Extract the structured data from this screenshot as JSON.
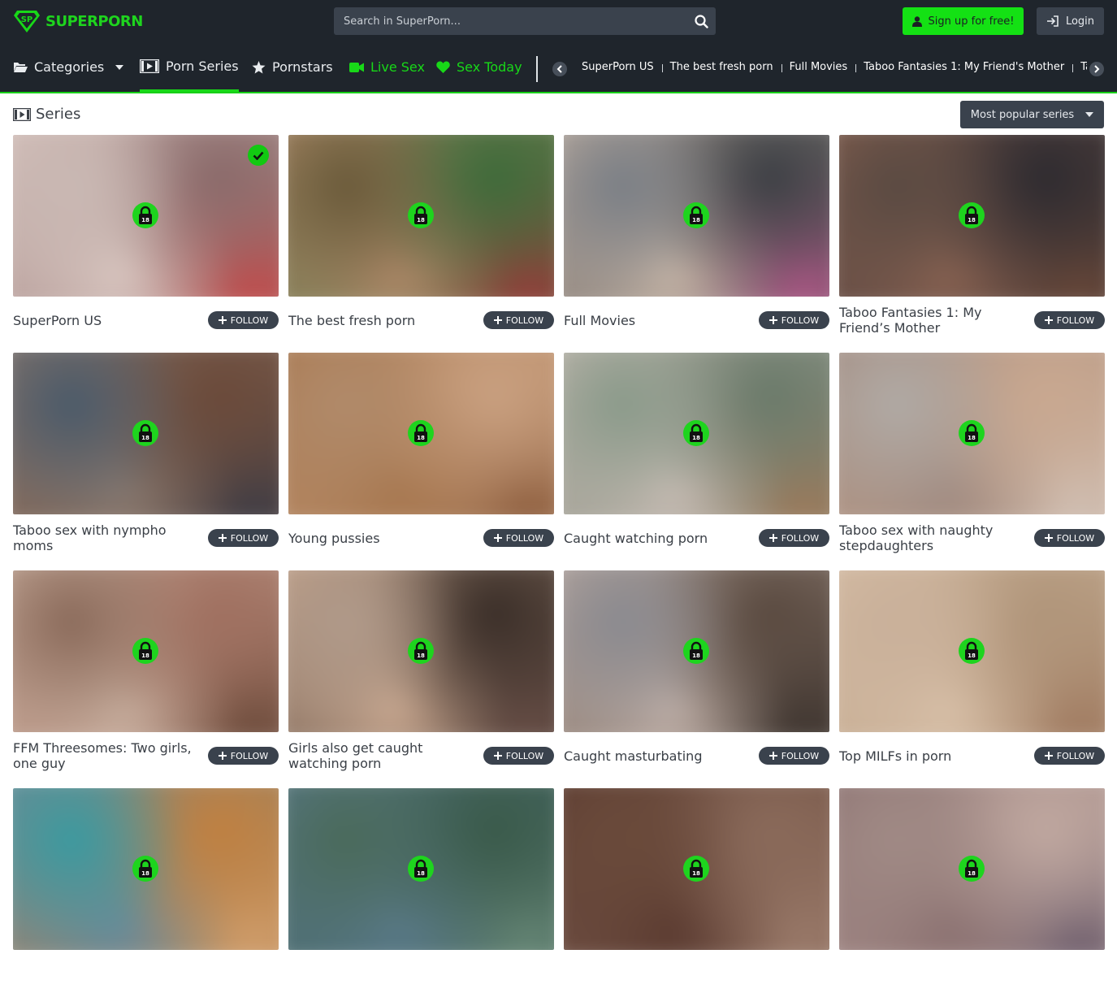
{
  "brand": {
    "name": "SUPERPORN",
    "logo_text": "SP",
    "accent": "#18d818"
  },
  "search": {
    "placeholder": "Search in SuperPorn...",
    "icon": "search-icon"
  },
  "auth": {
    "signup_label": "Sign up for free!",
    "login_label": "Login"
  },
  "nav": {
    "categories": "Categories",
    "porn_series": "Porn Series",
    "pornstars": "Pornstars",
    "live_sex": "Live Sex",
    "sex_today": "Sex Today"
  },
  "series_strip": [
    "SuperPorn US",
    "The best fresh porn",
    "Full Movies",
    "Taboo Fantasies 1: My Friend's Mother",
    "Taboo sex with nympho moms"
  ],
  "page": {
    "section_title": "Series",
    "sort_label": "Most popular series"
  },
  "follow_label": "FOLLOW",
  "lock_badge": "18",
  "cards": [
    {
      "title": "SuperPorn US",
      "followed": true,
      "colors": [
        "#c9b8b3",
        "#8a6a6a",
        "#d9c6c0",
        "#c54a4a"
      ]
    },
    {
      "title": "The best fresh porn",
      "followed": false,
      "colors": [
        "#6b5a3a",
        "#3e6b3a",
        "#b08a6a",
        "#9a3a3a"
      ]
    },
    {
      "title": "Full Movies",
      "followed": false,
      "colors": [
        "#7a7f86",
        "#3c3f44",
        "#c9b7a8",
        "#b45a8a"
      ]
    },
    {
      "title": "Taboo Fantasies 1: My Friend’s Mother",
      "followed": false,
      "colors": [
        "#5a4a42",
        "#2e2b30",
        "#8a6352",
        "#6d4a3a"
      ]
    },
    {
      "title": "Taboo sex with nympho moms",
      "followed": false,
      "colors": [
        "#4a5a6a",
        "#6b4a3a",
        "#8a7a70",
        "#3c3c46"
      ]
    },
    {
      "title": "Young pussies",
      "followed": false,
      "colors": [
        "#b08a6a",
        "#c9a080",
        "#a6764e",
        "#8a5a3a"
      ]
    },
    {
      "title": "Caught watching porn",
      "followed": false,
      "colors": [
        "#8a9a8a",
        "#6a7a6a",
        "#c9bdb5",
        "#a07a5a"
      ]
    },
    {
      "title": "Taboo sex with naughty stepdaughters",
      "followed": false,
      "colors": [
        "#b0aaa5",
        "#c9a890",
        "#a08a80",
        "#d0c0b5"
      ]
    },
    {
      "title": "FFM Threesomes: Two girls, one guy",
      "followed": false,
      "colors": [
        "#8a6a5a",
        "#a07060",
        "#c9b0a0",
        "#6a4a3a"
      ]
    },
    {
      "title": "Girls also get caught watching porn",
      "followed": false,
      "colors": [
        "#b09a8a",
        "#3a2e28",
        "#c9a890",
        "#6a5048"
      ]
    },
    {
      "title": "Caught masturbating",
      "followed": false,
      "colors": [
        "#8a8a90",
        "#5a4a40",
        "#c0b0a8",
        "#3e3530"
      ]
    },
    {
      "title": "Top MILFs in porn",
      "followed": false,
      "colors": [
        "#c9b09a",
        "#b0957a",
        "#d8c0a8",
        "#a07a60"
      ]
    },
    {
      "title": "",
      "followed": false,
      "colors": [
        "#3a9aa0",
        "#c08040",
        "#6a8a9a",
        "#d0a070"
      ]
    },
    {
      "title": "",
      "followed": false,
      "colors": [
        "#4a6a5a",
        "#3a5a4a",
        "#5a7a8a",
        "#6a8a7a"
      ]
    },
    {
      "title": "",
      "followed": false,
      "colors": [
        "#6a4a3a",
        "#8a6a5a",
        "#5a3a30",
        "#9a7a6a"
      ]
    },
    {
      "title": "",
      "followed": false,
      "colors": [
        "#a08a85",
        "#c0a8a0",
        "#8a7070",
        "#6a5a6a"
      ]
    }
  ]
}
